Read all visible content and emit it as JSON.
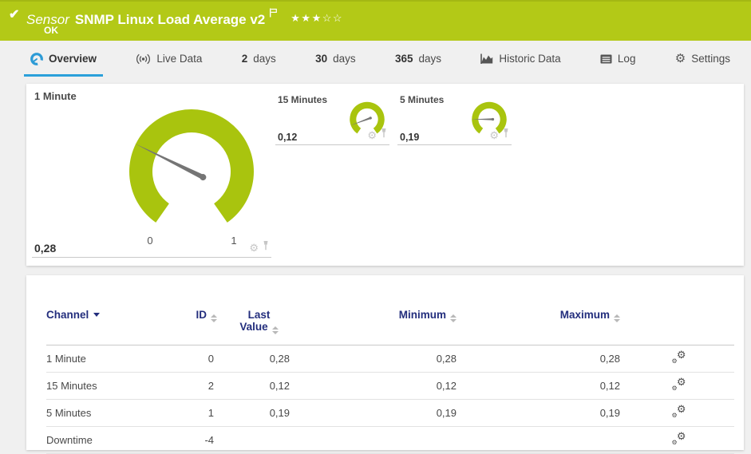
{
  "banner": {
    "type_label": "Sensor",
    "title": "SNMP Linux Load Average v2",
    "status": "OK",
    "stars_text": "★★★☆☆",
    "stars_filled": 3,
    "stars_total": 5,
    "color": "#b3c917"
  },
  "tabs": [
    {
      "label": "Overview",
      "icon": "gauge-icon",
      "active": true
    },
    {
      "label": "Live Data",
      "icon": "broadcast-icon",
      "active": false
    },
    {
      "number": "2",
      "label": "days",
      "active": false
    },
    {
      "number": "30",
      "label": "days",
      "active": false
    },
    {
      "number": "365",
      "label": "days",
      "active": false
    },
    {
      "label": "Historic Data",
      "icon": "area-chart-icon",
      "active": false
    },
    {
      "label": "Log",
      "icon": "log-icon",
      "active": false
    },
    {
      "label": "Settings",
      "icon": "gear-icon",
      "active": false
    }
  ],
  "accent": {
    "tab_underline": "#2ba0da",
    "gauge_green": "#a9c40e",
    "header_navy": "#232e7d"
  },
  "gauges": [
    {
      "name": "1 Minute",
      "value_text": "0,28",
      "value": 0.28,
      "min": 0,
      "max": 1,
      "scale_min_label": "0",
      "scale_max_label": "1"
    },
    {
      "name": "15 Minutes",
      "value_text": "0,12",
      "value": 0.12,
      "min": 0,
      "max": 1
    },
    {
      "name": "5 Minutes",
      "value_text": "0,19",
      "value": 0.19,
      "min": 0,
      "max": 1
    }
  ],
  "chart_data": [
    {
      "type": "gauge",
      "title": "1 Minute",
      "value": 0.28,
      "min": 0,
      "max": 1,
      "displayed_value": "0,28",
      "tick_labels": [
        "0",
        "1"
      ]
    },
    {
      "type": "gauge",
      "title": "15 Minutes",
      "value": 0.12,
      "min": 0,
      "max": 1,
      "displayed_value": "0,12"
    },
    {
      "type": "gauge",
      "title": "5 Minutes",
      "value": 0.19,
      "min": 0,
      "max": 1,
      "displayed_value": "0,19"
    }
  ],
  "table": {
    "columns": [
      {
        "label": "Channel",
        "sorted": "desc"
      },
      {
        "label": "ID"
      },
      {
        "label": "Last Value",
        "line1": "Last",
        "line2": "Value"
      },
      {
        "label": "Minimum"
      },
      {
        "label": "Maximum"
      }
    ],
    "rows": [
      {
        "channel": "1 Minute",
        "id": "0",
        "last": "0,28",
        "min": "0,28",
        "max": "0,28"
      },
      {
        "channel": "15 Minutes",
        "id": "2",
        "last": "0,12",
        "min": "0,12",
        "max": "0,12"
      },
      {
        "channel": "5 Minutes",
        "id": "1",
        "last": "0,19",
        "min": "0,19",
        "max": "0,19"
      },
      {
        "channel": "Downtime",
        "id": "-4",
        "last": "",
        "min": "",
        "max": ""
      }
    ]
  }
}
